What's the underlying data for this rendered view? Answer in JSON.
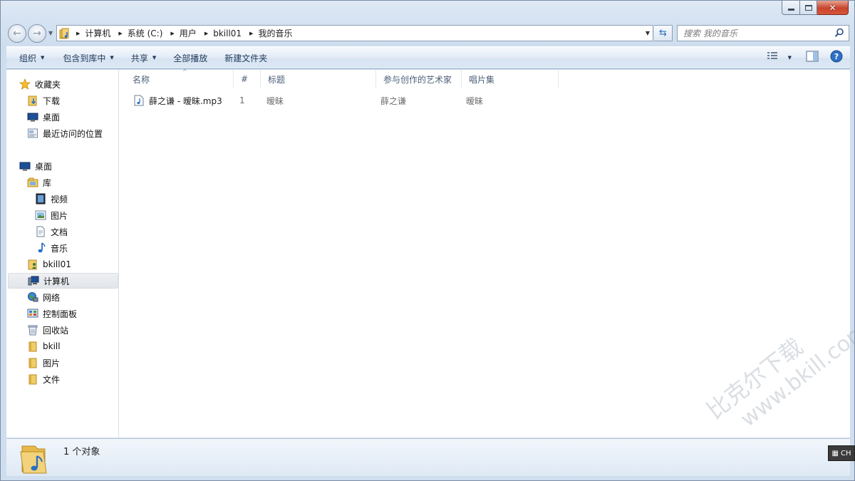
{
  "window": {
    "title_buttons": {
      "minimize": "minimize",
      "maximize": "maximize",
      "close": "✕"
    }
  },
  "address": {
    "crumbs": [
      "计算机",
      "系统 (C:)",
      "用户",
      "bkill01",
      "我的音乐"
    ]
  },
  "search": {
    "placeholder": "搜索 我的音乐"
  },
  "toolbar": {
    "organize": "组织",
    "include_in_library": "包含到库中",
    "share": "共享",
    "play_all": "全部播放",
    "new_folder": "新建文件夹"
  },
  "nav": {
    "favorites": {
      "label": "收藏夹",
      "items": [
        "下载",
        "桌面",
        "最近访问的位置"
      ]
    },
    "desktop": {
      "label": "桌面",
      "library": {
        "label": "库",
        "items": [
          "视频",
          "图片",
          "文档",
          "音乐"
        ]
      },
      "items": [
        "bkill01",
        "计算机",
        "网络",
        "控制面板",
        "回收站",
        "bkill",
        "图片",
        "文件"
      ]
    },
    "selected": "计算机"
  },
  "columns": [
    "名称",
    "#",
    "标题",
    "参与创作的艺术家",
    "唱片集"
  ],
  "files": [
    {
      "name": "薛之谦 - 暧昧.mp3",
      "number": "1",
      "title": "暧昧",
      "artist": "薛之谦",
      "album": "暧昧"
    }
  ],
  "details": {
    "count_text": "1 个对象"
  },
  "watermark": {
    "line1": "比克尔下载",
    "line2": "www.bkill.com"
  },
  "ime": {
    "label": "CH"
  },
  "colors": {
    "accent": "#1e395b",
    "window_frame": "#cfdeee",
    "selection": "#e2e5ea"
  }
}
